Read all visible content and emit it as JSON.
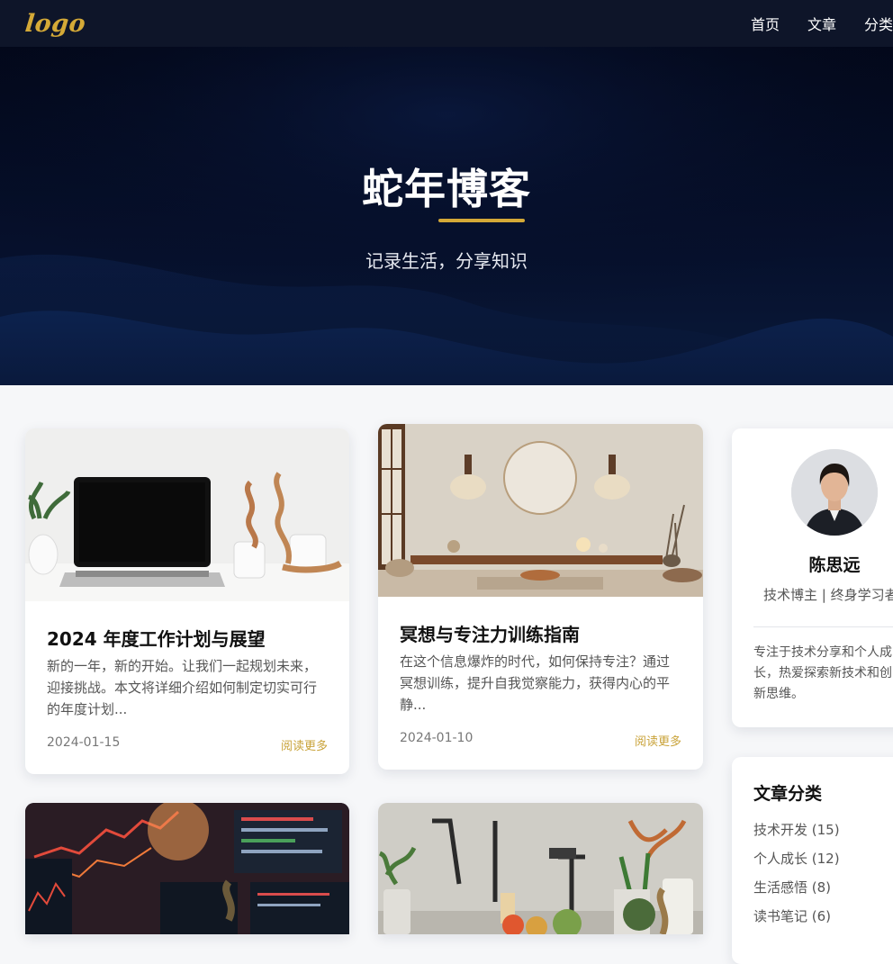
{
  "nav": {
    "logo": "logo",
    "links": [
      "首页",
      "文章",
      "分类"
    ]
  },
  "hero": {
    "title": "蛇年博客",
    "subtitle": "记录生活，分享知识"
  },
  "posts": [
    {
      "title": "2024 年度工作计划与展望",
      "excerpt": "新的一年，新的开始。让我们一起规划未来，迎接挑战。本文将详细介绍如何制定切实可行的年度计划...",
      "date": "2024-01-15",
      "more": "阅读更多"
    },
    {
      "title": "冥想与专注力训练指南",
      "excerpt": "在这个信息爆炸的时代，如何保持专注？通过冥想训练，提升自我觉察能力，获得内心的平静...",
      "date": "2024-01-10",
      "more": "阅读更多"
    }
  ],
  "author": {
    "name": "陈思远",
    "title": "技术博主 | 终身学习者",
    "bio_lines": [
      "专注于技术分享和个人成",
      "长，热爱探索新技术和创",
      "新思维。"
    ]
  },
  "categories": {
    "heading": "文章分类",
    "items": [
      "技术开发 (15)",
      "个人成长 (12)",
      "生活感悟 (8)",
      "读书笔记 (6)"
    ]
  },
  "colors": {
    "nav_bg": "#0e1529",
    "accent": "#d4a937",
    "hero_bg": "#03081a",
    "page_bg": "#f6f7f9"
  }
}
